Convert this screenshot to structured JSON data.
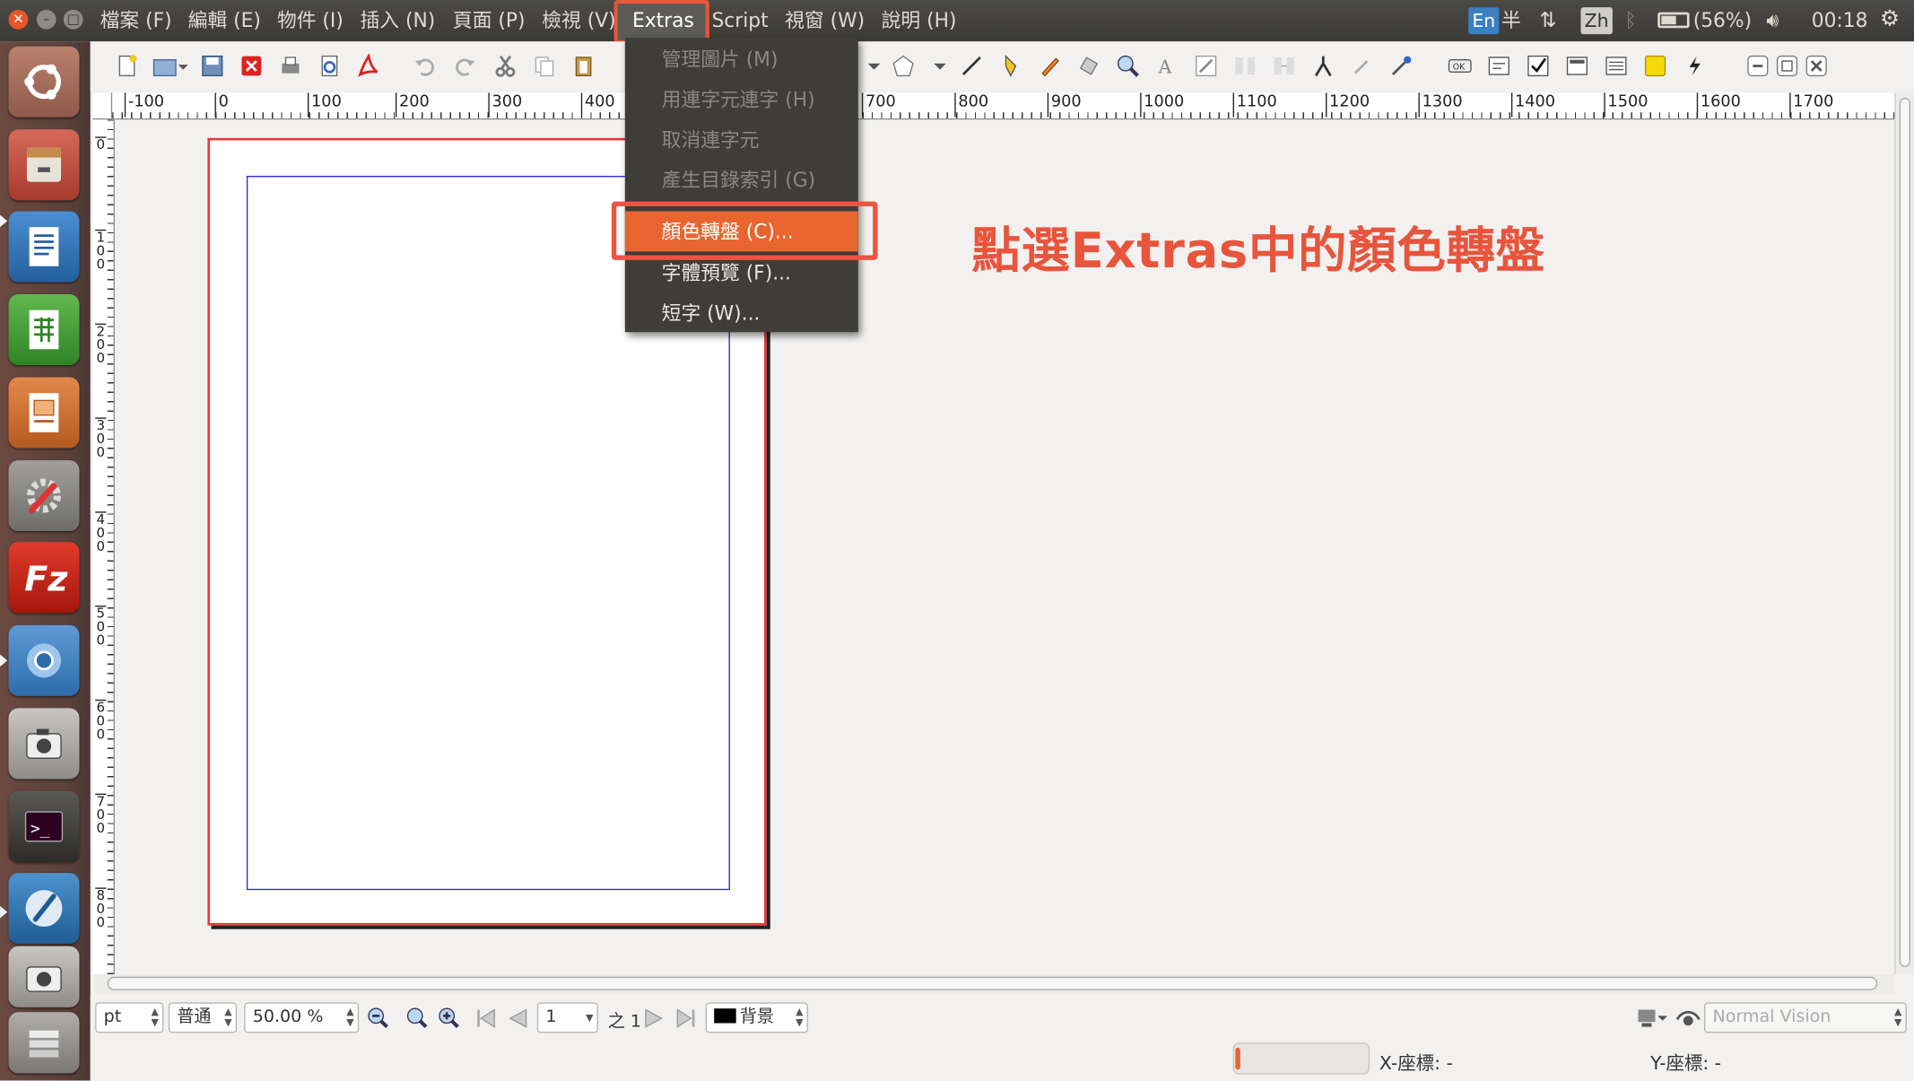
{
  "menubar": {
    "items": [
      "檔案 (F)",
      "編輯 (E)",
      "物件 (I)",
      "插入 (N)",
      "頁面 (P)",
      "檢視 (V)",
      "Extras",
      "Script",
      "視窗 (W)",
      "說明 (H)"
    ],
    "active": "Extras"
  },
  "tray": {
    "input_en": "En",
    "half": "半",
    "input_zh": "Zh",
    "battery": "(56%)",
    "clock": "00:18"
  },
  "ruler": {
    "h_labels": [
      "-100",
      "0",
      "100",
      "200",
      "300",
      "400",
      "700",
      "800",
      "900",
      "1000",
      "1100",
      "1200",
      "1300",
      "1400",
      "1500",
      "1600",
      "1700"
    ],
    "v_labels": [
      "0",
      "1 0 0",
      "2 0 0",
      "3 0 0",
      "4 0 0",
      "5 0 0",
      "6 0 0",
      "7 0 0",
      "8 0 0"
    ]
  },
  "extras_menu": {
    "items": [
      {
        "label": "管理圖片 (M)",
        "enabled": false
      },
      {
        "label": "用連字元連字 (H)",
        "enabled": false
      },
      {
        "label": "取消連字元",
        "enabled": false
      },
      {
        "label": "產生目錄索引 (G)",
        "enabled": false
      },
      {
        "label": "顏色轉盤 (C)...",
        "enabled": true,
        "highlighted": true
      },
      {
        "label": "字體預覽 (F)...",
        "enabled": true
      },
      {
        "label": "短字 (W)...",
        "enabled": true
      }
    ]
  },
  "annotation": "點選Extras中的顏色轉盤",
  "statusbar": {
    "unit": "pt",
    "mode": "普通",
    "zoom": "50.00 %",
    "page": "1",
    "page_of": "之 1",
    "layer": "背景",
    "vision": "Normal Vision",
    "x_coord": "X-座標: -",
    "y_coord": "Y-座標: -"
  },
  "colors": {
    "accent": "#e9652f",
    "highlight_border": "#ec5540",
    "menu_bg": "#3e3d39",
    "page_border": "#e63a3a",
    "margin_line": "#2a2ad4"
  }
}
